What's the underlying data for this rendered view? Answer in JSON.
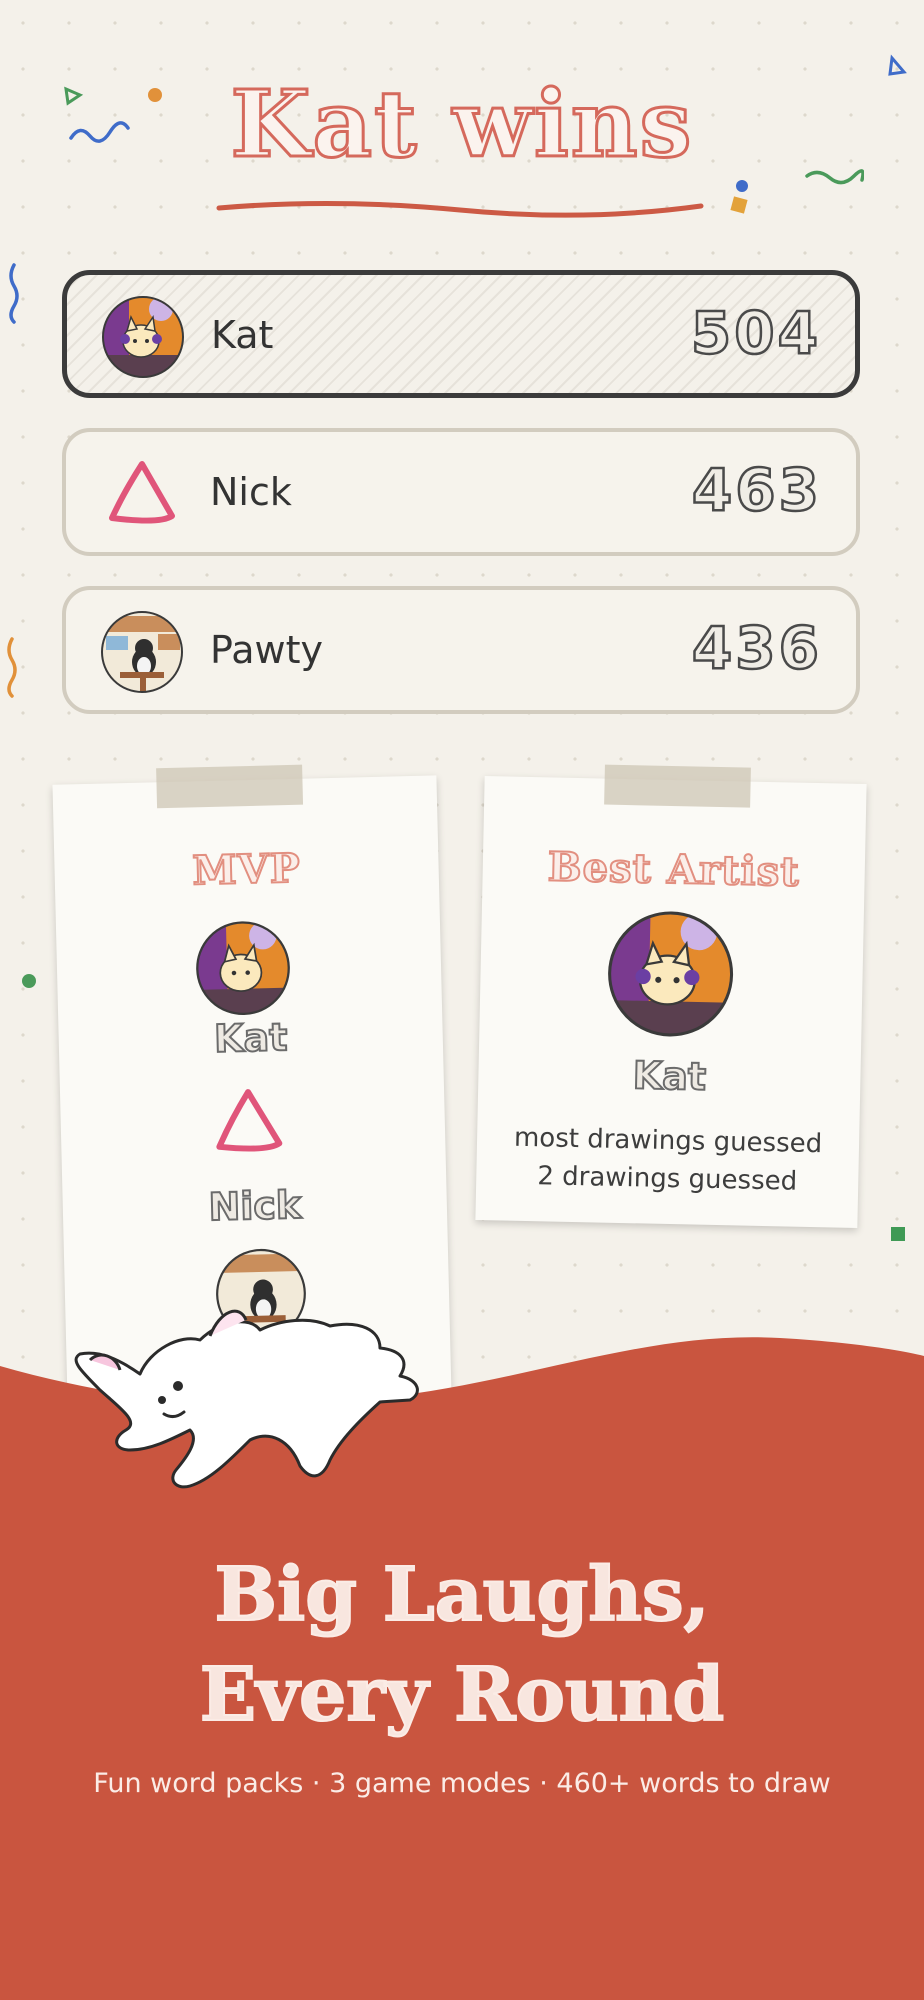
{
  "header": {
    "title": "Kat wins"
  },
  "scoreboard": [
    {
      "name": "Kat",
      "score": "504",
      "avatar": "cat-dj-avatar"
    },
    {
      "name": "Nick",
      "score": "463",
      "avatar": "pink-triangle-avatar"
    },
    {
      "name": "Pawty",
      "score": "436",
      "avatar": "penguin-cafe-avatar"
    }
  ],
  "awards": {
    "mvp": {
      "title": "MVP",
      "names": [
        "Kat",
        "Nick"
      ]
    },
    "best_artist": {
      "title": "Best Artist",
      "name": "Kat",
      "desc_line1": "most drawings guessed",
      "desc_line2": "2 drawings guessed"
    }
  },
  "promo": {
    "headline_line1": "Big Laughs,",
    "headline_line2": "Every Round",
    "tagline": "Fun word packs · 3 game modes · 460+ words to draw"
  },
  "colors": {
    "accent_red": "#c9553f",
    "title_outline": "#d5695c",
    "triangle_pink": "#e0557a",
    "background": "#f4f1ea"
  }
}
